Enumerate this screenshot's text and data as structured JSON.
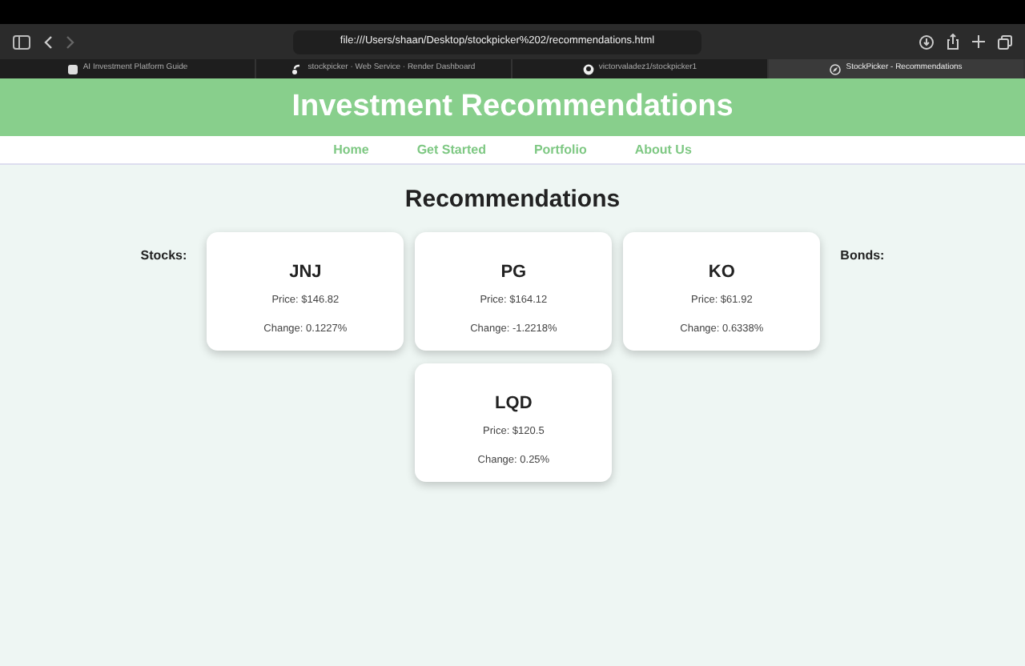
{
  "browser": {
    "url": "file:///Users/shaan/Desktop/stockpicker%202/recommendations.html",
    "tabs": [
      {
        "label": "AI Investment Platform Guide",
        "kind": "doc",
        "selected": false
      },
      {
        "label": "stockpicker · Web Service · Render Dashboard",
        "kind": "render",
        "selected": false
      },
      {
        "label": "victorvaladez1/stockpicker1",
        "kind": "github",
        "selected": false
      },
      {
        "label": "StockPicker - Recommendations",
        "kind": "compass",
        "selected": true
      }
    ]
  },
  "header": {
    "title": "Investment Recommendations"
  },
  "nav": [
    "Home",
    "Get Started",
    "Portfolio",
    "About Us"
  ],
  "heading": "Recommendations",
  "stocks_label": "Stocks:",
  "bonds_label": "Bonds:",
  "cards": [
    {
      "symbol": "JNJ",
      "price": "Price: $146.82",
      "change": "Change: 0.1227%"
    },
    {
      "symbol": "PG",
      "price": "Price: $164.12",
      "change": "Change: -1.2218%"
    },
    {
      "symbol": "KO",
      "price": "Price: $61.92",
      "change": "Change: 0.6338%"
    },
    {
      "symbol": "LQD",
      "price": "Price: $120.5",
      "change": "Change: 0.25%"
    }
  ]
}
